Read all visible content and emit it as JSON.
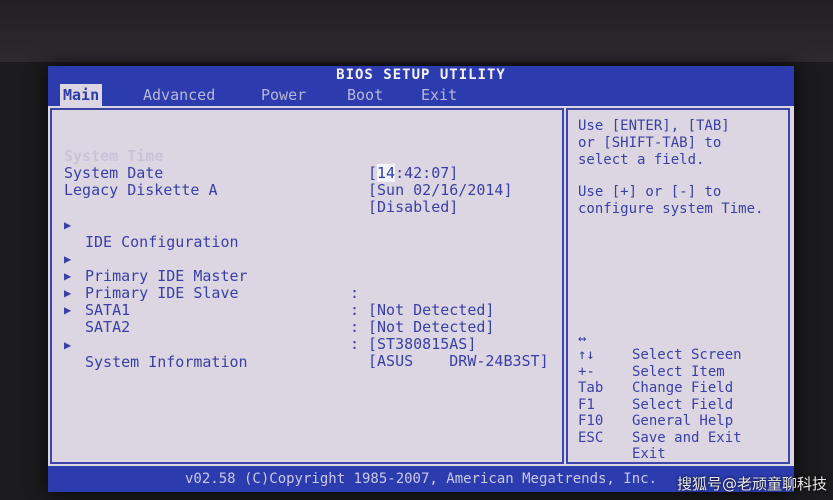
{
  "title": "BIOS SETUP UTILITY",
  "menu": [
    {
      "label": "Main",
      "active": true
    },
    {
      "label": "Advanced",
      "active": false
    },
    {
      "label": "Power",
      "active": false
    },
    {
      "label": "Boot",
      "active": false
    },
    {
      "label": "Exit",
      "active": false
    }
  ],
  "main": {
    "system_time": {
      "label": "System Time",
      "value_prefix": "[",
      "value_hl": "14",
      "value_rest": ":42:07]"
    },
    "system_date": {
      "label": "System Date",
      "value": "[Sun 02/16/2014]"
    },
    "legacy_diskette": {
      "label": "Legacy Diskette A",
      "value": "[Disabled]"
    },
    "ide_config": {
      "label": "IDE Configuration"
    },
    "drives": [
      {
        "label": "Primary IDE Master",
        "colon": ":",
        "value": "[Not Detected]"
      },
      {
        "label": "Primary IDE Slave",
        "colon": ":",
        "value": "[Not Detected]"
      },
      {
        "label": "SATA1",
        "colon": ":",
        "value": "[ST380815AS]"
      },
      {
        "label": "SATA2",
        "colon": ":",
        "value": "[ASUS    DRW-24B3ST]"
      }
    ],
    "system_info": {
      "label": "System Information"
    },
    "arrow": "▶"
  },
  "help": {
    "line1": "Use [ENTER], [TAB]",
    "line2": "or [SHIFT-TAB] to",
    "line3": "select a field.",
    "line4": "Use [+] or [-] to",
    "line5": "configure system Time.",
    "keys": [
      {
        "key": "↔",
        "desc": "Select Screen"
      },
      {
        "key": "↑↓",
        "desc": "Select Item"
      },
      {
        "key": "+-",
        "desc": "Change Field"
      },
      {
        "key": "Tab",
        "desc": "Select Field"
      },
      {
        "key": "F1",
        "desc": "General Help"
      },
      {
        "key": "F10",
        "desc": "Save and Exit"
      },
      {
        "key": "ESC",
        "desc": "Exit"
      }
    ]
  },
  "footer": "v02.58 (C)Copyright 1985-2007, American Megatrends, Inc.",
  "watermark": "搜狐号@老顽童聊科技"
}
